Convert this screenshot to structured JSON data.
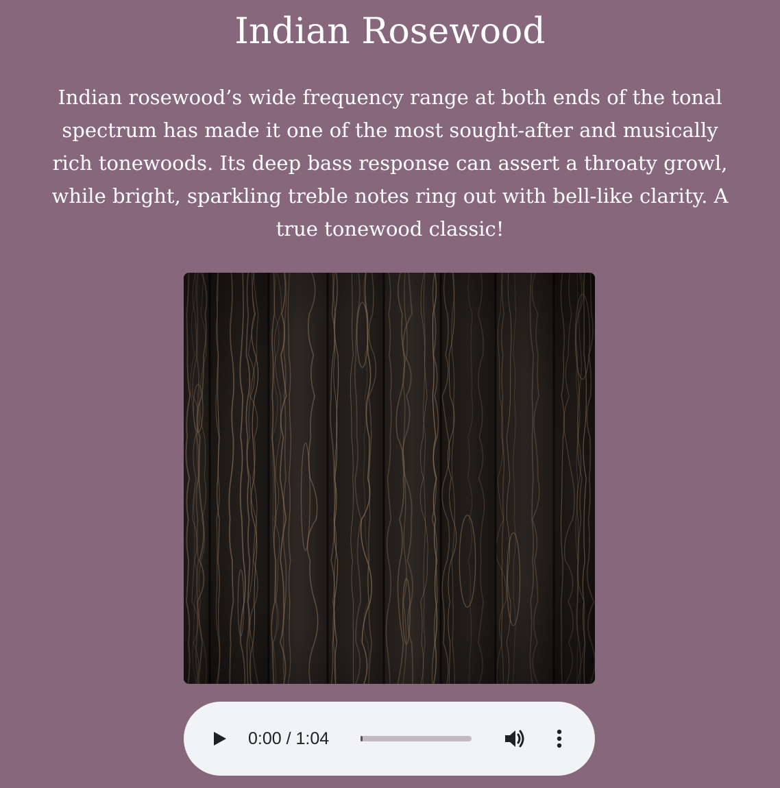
{
  "title": "Indian Rosewood",
  "description": "Indian rosewood’s wide frequency range at both ends of the tonal spectrum has made it one of the most sought-after and musically rich tonewoods. Its deep bass response can assert a throaty growl, while bright, sparkling treble notes ring out with bell-like clarity. A true tonewood classic!",
  "image": {
    "subject": "dark rosewood plank texture"
  },
  "audio_player": {
    "time_display": "0:00 / 1:04",
    "current_time": "0:00",
    "duration": "1:04",
    "progress_fraction": 0.01,
    "play_icon": "play-icon",
    "volume_icon": "volume-icon",
    "more_icon": "more-vertical-icon"
  },
  "colors": {
    "background": "#86677b",
    "text": "#ffffff",
    "player_background": "#f1f3f4",
    "player_icons": "#202124"
  }
}
